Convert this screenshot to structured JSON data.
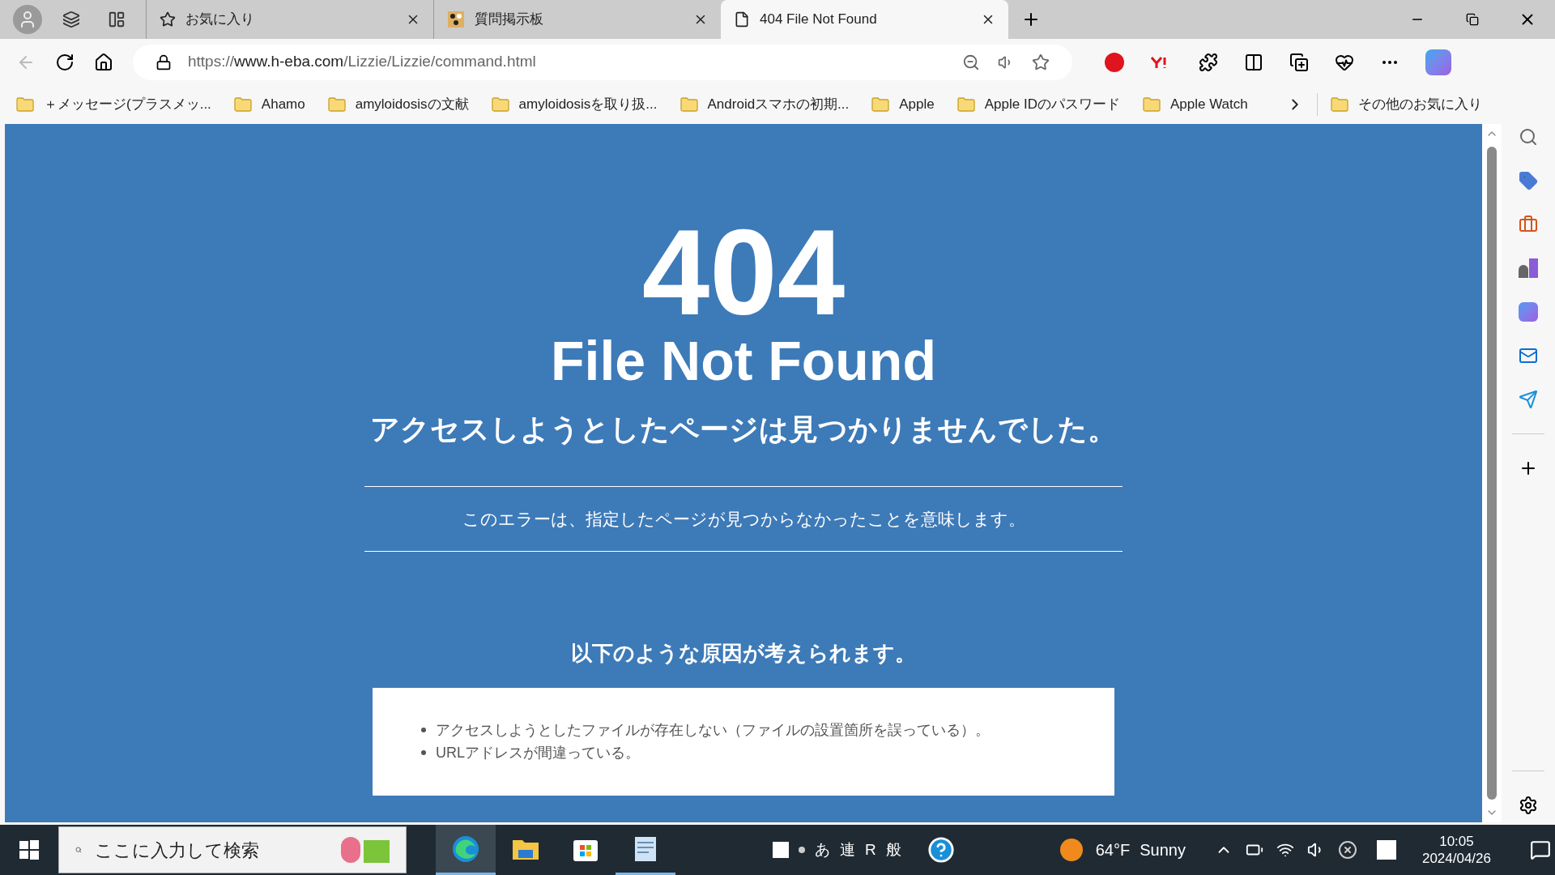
{
  "tabs": [
    {
      "kind": "favorites",
      "label": "お気に入り",
      "selected": false
    },
    {
      "kind": "board",
      "label": "質問掲示板",
      "selected": false
    },
    {
      "kind": "page",
      "label": "404 File Not Found",
      "selected": true
    }
  ],
  "address_bar": {
    "scheme": "https://",
    "host": "www.h-eba.com",
    "path": "/Lizzie/Lizzie/command.html"
  },
  "bookmarks": [
    "＋メッセージ(プラスメッ...",
    "Ahamo",
    "amyloidosisの文献",
    "amyloidosisを取り扱...",
    "Androidスマホの初期...",
    "Apple",
    "Apple IDのパスワード",
    "Apple Watch"
  ],
  "other_favorites": "その他のお気に入り",
  "page": {
    "code": "404",
    "title": "File Not Found",
    "subtitle": "アクセスしようとしたページは見つかりませんでした。",
    "description": "このエラーは、指定したページが見つからなかったことを意味します。",
    "causes_heading": "以下のような原因が考えられます。",
    "causes": [
      "アクセスしようとしたファイルが存在しない（ファイルの設置箇所を誤っている）。",
      "URLアドレスが間違っている。"
    ]
  },
  "taskbar": {
    "search": {
      "placeholder": "ここに入力して検索"
    },
    "apps": [
      {
        "kind": "edge",
        "selected": true
      },
      {
        "kind": "explorer",
        "selected": false
      },
      {
        "kind": "store",
        "selected": false
      },
      {
        "kind": "wordpad",
        "selected": true
      }
    ],
    "ime": [
      "あ",
      "連",
      "R",
      "般"
    ],
    "weather": {
      "temperature": "64°F",
      "condition": "Sunny"
    },
    "time": "10:05",
    "date": "2024/04/26"
  }
}
